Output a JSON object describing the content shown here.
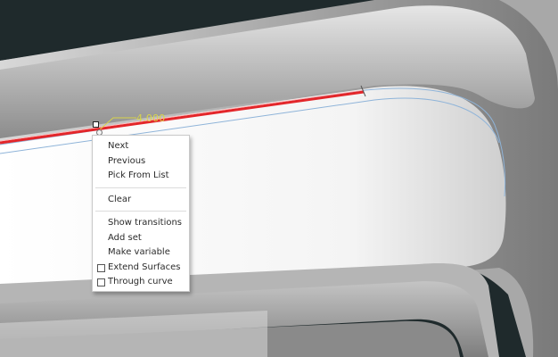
{
  "viewport": {
    "dimension_value": "4.000",
    "colors": {
      "background": "#1f2a2c",
      "surface_light": "#f3f3f3",
      "surface_gray": "#9a9a9a",
      "selected_edge": "#e3262a",
      "guide_curve": "#8fb4d9",
      "dimension_text": "#d8d44a"
    }
  },
  "context_menu": {
    "items_group1": [
      {
        "label": "Next"
      },
      {
        "label": "Previous"
      },
      {
        "label": "Pick From List"
      }
    ],
    "items_group2": [
      {
        "label": "Clear"
      }
    ],
    "items_group3": [
      {
        "label": "Show transitions"
      },
      {
        "label": "Add set"
      },
      {
        "label": "Make variable"
      }
    ],
    "checkbox_items": [
      {
        "label": "Extend Surfaces",
        "checked": false
      },
      {
        "label": "Through curve",
        "checked": false
      }
    ]
  }
}
